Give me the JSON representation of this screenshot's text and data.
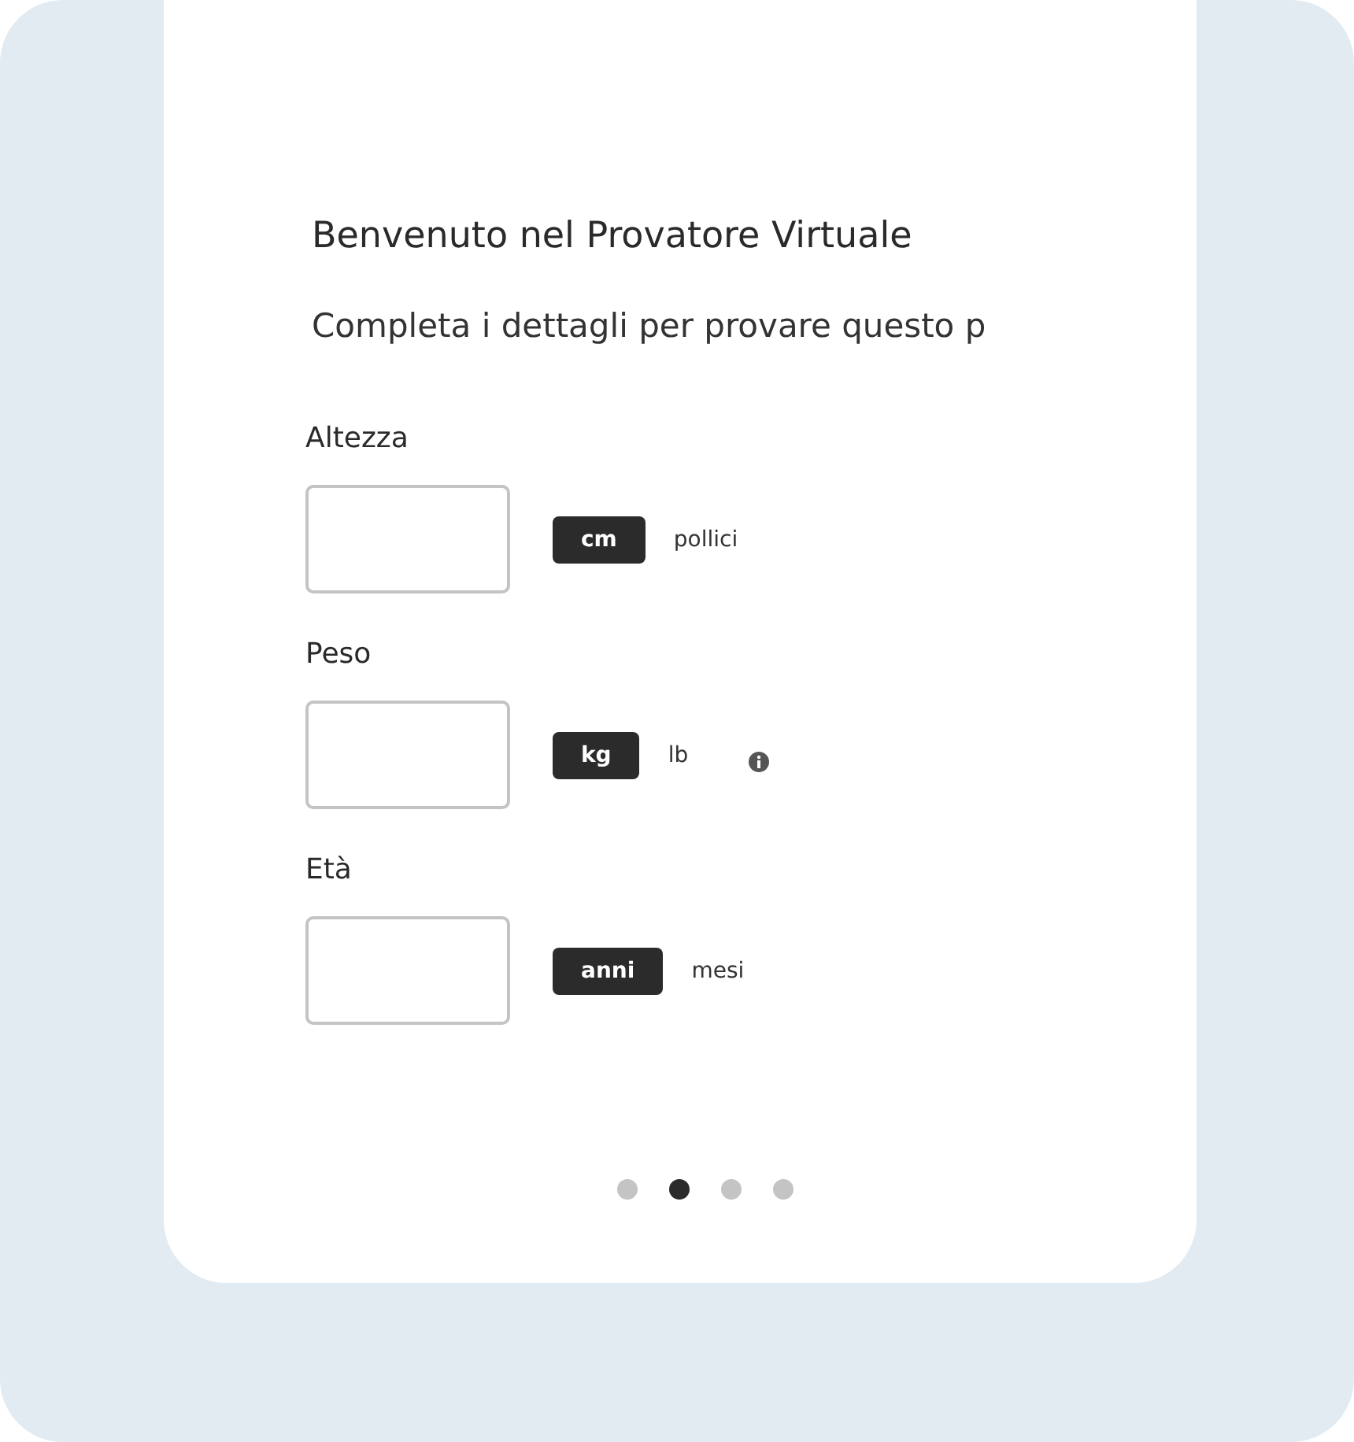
{
  "title": "Benvenuto nel Provatore Virtuale",
  "subtitle": "Completa i dettagli per provare questo p",
  "fields": [
    {
      "label": "Altezza",
      "units": [
        {
          "label": "cm",
          "selected": true
        },
        {
          "label": "pollici",
          "selected": false
        }
      ],
      "info": false
    },
    {
      "label": "Peso",
      "units": [
        {
          "label": "kg",
          "selected": true
        },
        {
          "label": "lb",
          "selected": false
        }
      ],
      "info": true
    },
    {
      "label": "Età",
      "units": [
        {
          "label": "anni",
          "selected": true
        },
        {
          "label": "mesi",
          "selected": false
        }
      ],
      "info": false
    }
  ],
  "pager": [
    {
      "selected": false
    },
    {
      "selected": true
    },
    {
      "selected": false
    },
    {
      "selected": false
    }
  ]
}
